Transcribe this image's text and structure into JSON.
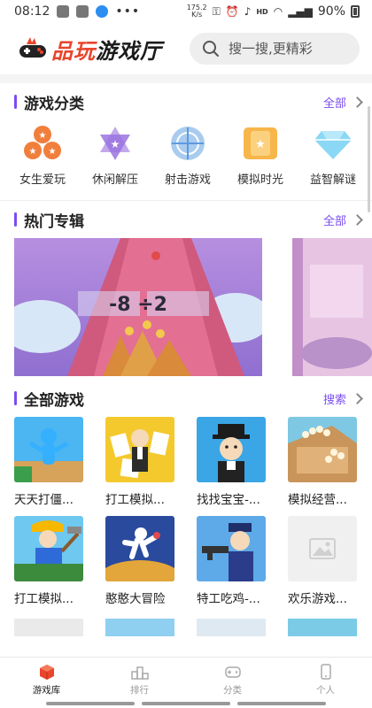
{
  "status": {
    "time": "08:12",
    "net_speed_top": "175.2",
    "net_speed_bottom": "K/s",
    "hd_label": "HD",
    "battery": "90%"
  },
  "header": {
    "logo_text_accent": "品玩",
    "logo_text": "游戏厅",
    "search_placeholder": "搜一搜,更精彩"
  },
  "categories_section": {
    "title": "游戏分类",
    "more": "全部",
    "items": [
      {
        "label": "女生爱玩",
        "icon": "coins-icon"
      },
      {
        "label": "休闲解压",
        "icon": "star-of-david-icon"
      },
      {
        "label": "射击游戏",
        "icon": "crosshair-icon"
      },
      {
        "label": "模拟时光",
        "icon": "star-card-icon"
      },
      {
        "label": "益智解谜",
        "icon": "diamond-icon"
      }
    ]
  },
  "albums_section": {
    "title": "热门专辑",
    "more": "全部",
    "banner_text": "-8  ÷2"
  },
  "games_section": {
    "title": "全部游戏",
    "more": "搜索",
    "games": [
      {
        "name": "天天打僵..."
      },
      {
        "name": "打工模拟..."
      },
      {
        "name": "找找宝宝-..."
      },
      {
        "name": "模拟经营..."
      },
      {
        "name": "打工模拟..."
      },
      {
        "name": "憨憨大冒险"
      },
      {
        "name": "特工吃鸡-..."
      },
      {
        "name": "欢乐游戏..."
      }
    ]
  },
  "tabbar": {
    "tabs": [
      {
        "label": "游戏库",
        "active": true
      },
      {
        "label": "排行",
        "active": false
      },
      {
        "label": "分类",
        "active": false
      },
      {
        "label": "个人",
        "active": false
      }
    ]
  },
  "colors": {
    "accent": "#7a4df0",
    "brand_red": "#e8452c"
  }
}
